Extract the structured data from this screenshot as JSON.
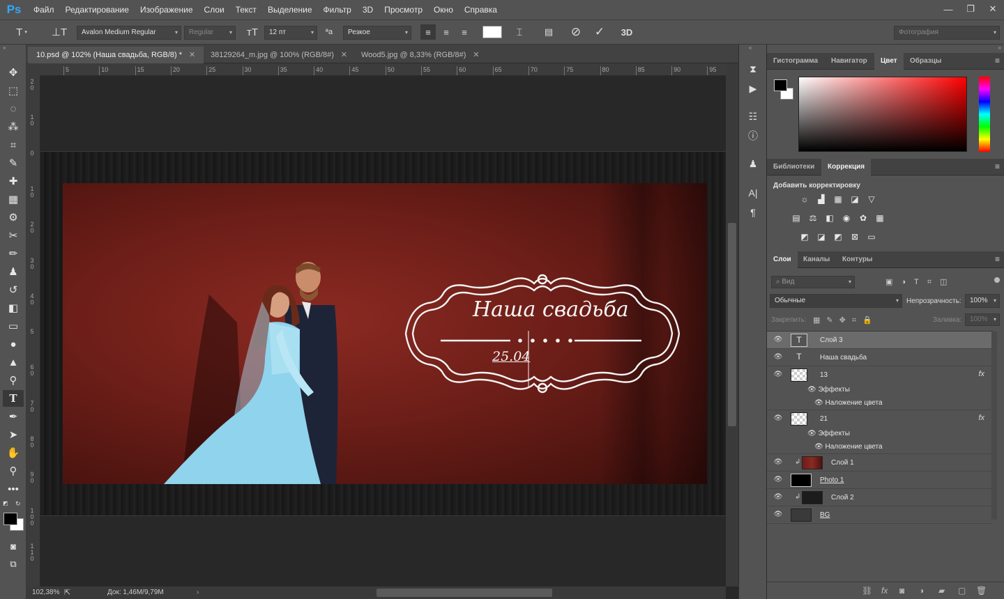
{
  "app": {
    "logo": "Ps",
    "menu": [
      "Файл",
      "Редактирование",
      "Изображение",
      "Слои",
      "Текст",
      "Выделение",
      "Фильтр",
      "3D",
      "Просмотр",
      "Окно",
      "Справка"
    ],
    "window_controls": [
      "—",
      "❐",
      "✕"
    ]
  },
  "options": {
    "font_family": "Avalon Medium Regular",
    "font_style": "Regular",
    "font_size": "12 пт",
    "antialias": "Резкое",
    "workspace": "Фотография",
    "aa_icon": "ªa",
    "threed": "3D",
    "color_swatch": "#ffffff"
  },
  "tabs": [
    {
      "label": "10.psd @ 102% (Наша свадьба, RGB/8) *"
    },
    {
      "label": "38129264_m.jpg @ 100% (RGB/8#)"
    },
    {
      "label": "Wood5.jpg @ 8,33% (RGB/8#)"
    }
  ],
  "ruler": {
    "h": [
      "5",
      "10",
      "15",
      "20",
      "25",
      "30",
      "35",
      "40",
      "45",
      "50",
      "55",
      "60",
      "65",
      "70",
      "75",
      "80",
      "85",
      "90",
      "95"
    ],
    "v": [
      "2 0",
      "1 0",
      "0",
      "1 0",
      "2 0",
      "3 0",
      "4 0",
      "5",
      "6 0",
      "7 0",
      "8 0",
      "9 0",
      "1 0 0",
      "1 1 0"
    ]
  },
  "canvas": {
    "title": "Наша свадьба",
    "date": "25.04"
  },
  "status": {
    "zoom": "102,38%",
    "doc": "Док: 1,46M/9,79M"
  },
  "color_panel": {
    "tabs": [
      "Гистограмма",
      "Навигатор",
      "Цвет",
      "Образцы"
    ],
    "active": 2,
    "fg": "#000000",
    "bg": "#ffffff"
  },
  "adjust_panel": {
    "tabs": [
      "Библиотеки",
      "Коррекция"
    ],
    "active": 1,
    "heading": "Добавить корректировку"
  },
  "layers_panel": {
    "tabs": [
      "Слои",
      "Каналы",
      "Контуры"
    ],
    "active": 0,
    "filter_placeholder": "Вид",
    "blend": "Обычные",
    "opacity_label": "Непрозрачность:",
    "opacity": "100%",
    "lock_label": "Закрепить:",
    "fill_label": "Заливка:",
    "fill": "100%",
    "layers": [
      {
        "name": "Слой 3",
        "type": "text",
        "selected": true
      },
      {
        "name": "Наша свадьба",
        "type": "text"
      },
      {
        "name": "13",
        "type": "smart",
        "fx": "fx",
        "effects_label": "Эффекты",
        "effect": "Наложение цвета"
      },
      {
        "name": "21",
        "type": "smart",
        "fx": "fx",
        "effects_label": "Эффекты",
        "effect": "Наложение цвета"
      },
      {
        "name": "Слой 1",
        "type": "photo",
        "clip": true
      },
      {
        "name": "Photo 1",
        "type": "mask"
      },
      {
        "name": "Слой 2",
        "type": "dark",
        "clip": true
      },
      {
        "name": "BG",
        "type": "bg"
      }
    ]
  }
}
